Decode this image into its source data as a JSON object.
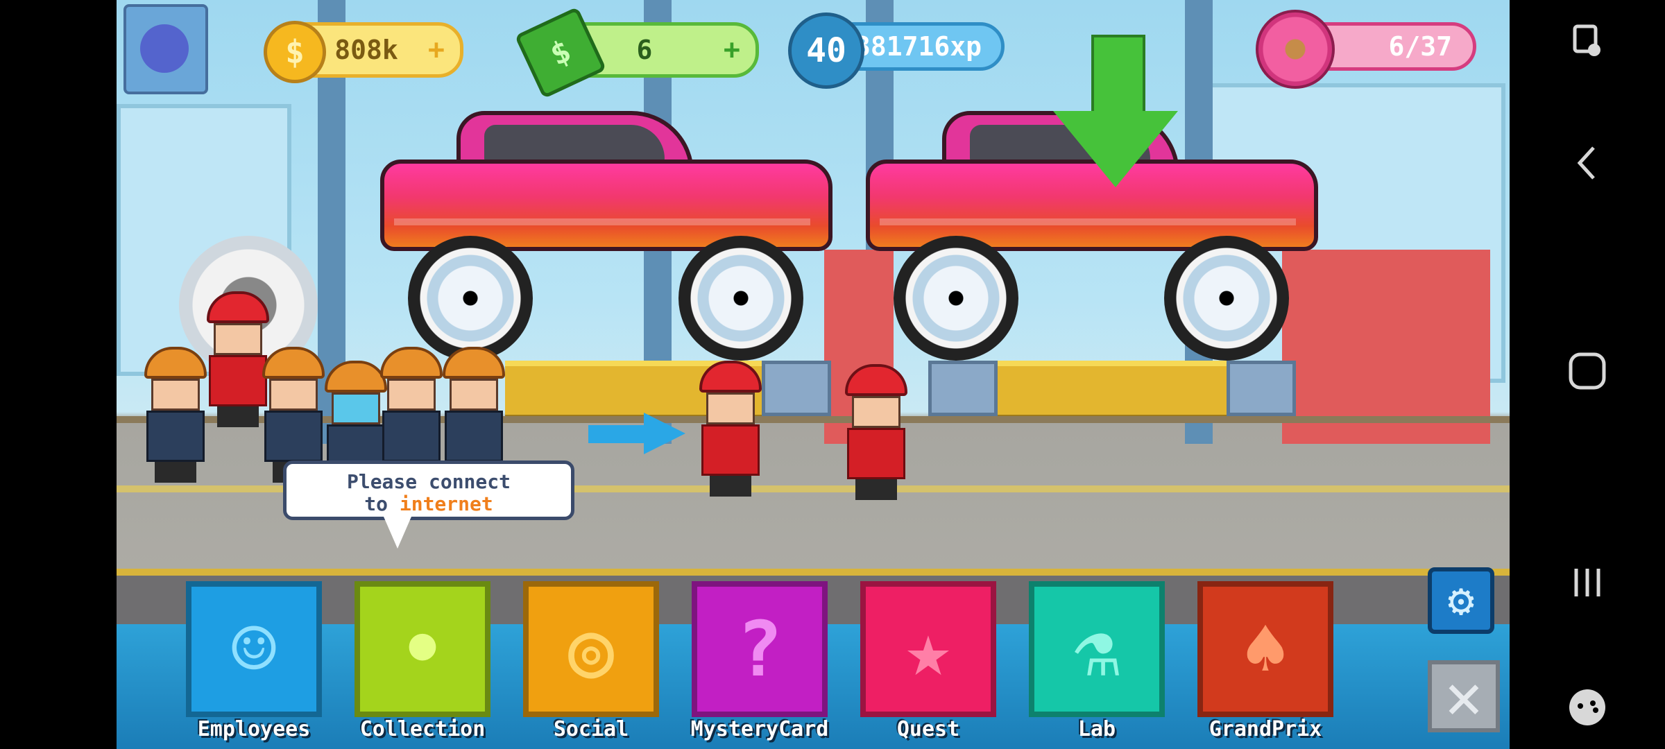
{
  "hud": {
    "coins": "808k",
    "cash": "6",
    "level": "40",
    "xp": "381716xp",
    "donuts": "6/37",
    "plus_symbol": "+"
  },
  "bubble": {
    "line1": "Please connect",
    "line2_prefix": "to ",
    "line2_highlight": "internet"
  },
  "menu": [
    {
      "label": "Employees",
      "color": "#1e9ee3",
      "glyph": "☺"
    },
    {
      "label": "Collection",
      "color": "#a4d41c",
      "glyph": "•"
    },
    {
      "label": "Social",
      "color": "#f0a010",
      "glyph": "◎"
    },
    {
      "label": "MysteryCard",
      "color": "#c21fc4",
      "glyph": "?"
    },
    {
      "label": "Quest",
      "color": "#ee1f64",
      "glyph": "★"
    },
    {
      "label": "Lab",
      "color": "#15c7a8",
      "glyph": "⚗"
    },
    {
      "label": "GrandPrix",
      "color": "#d23a1d",
      "glyph": "♠"
    }
  ],
  "icons": {
    "settings": "gear-icon",
    "close": "close-icon",
    "coin": "coin-icon",
    "cash": "cash-icon",
    "level": "level-badge-icon",
    "donut": "donut-icon",
    "arrow": "down-arrow-icon"
  },
  "colors": {
    "coin_bar": "#fbe57c",
    "cash_bar": "#bff08a",
    "xp_bar": "#6fc6f2",
    "donut_bar": "#f6a9c9"
  }
}
